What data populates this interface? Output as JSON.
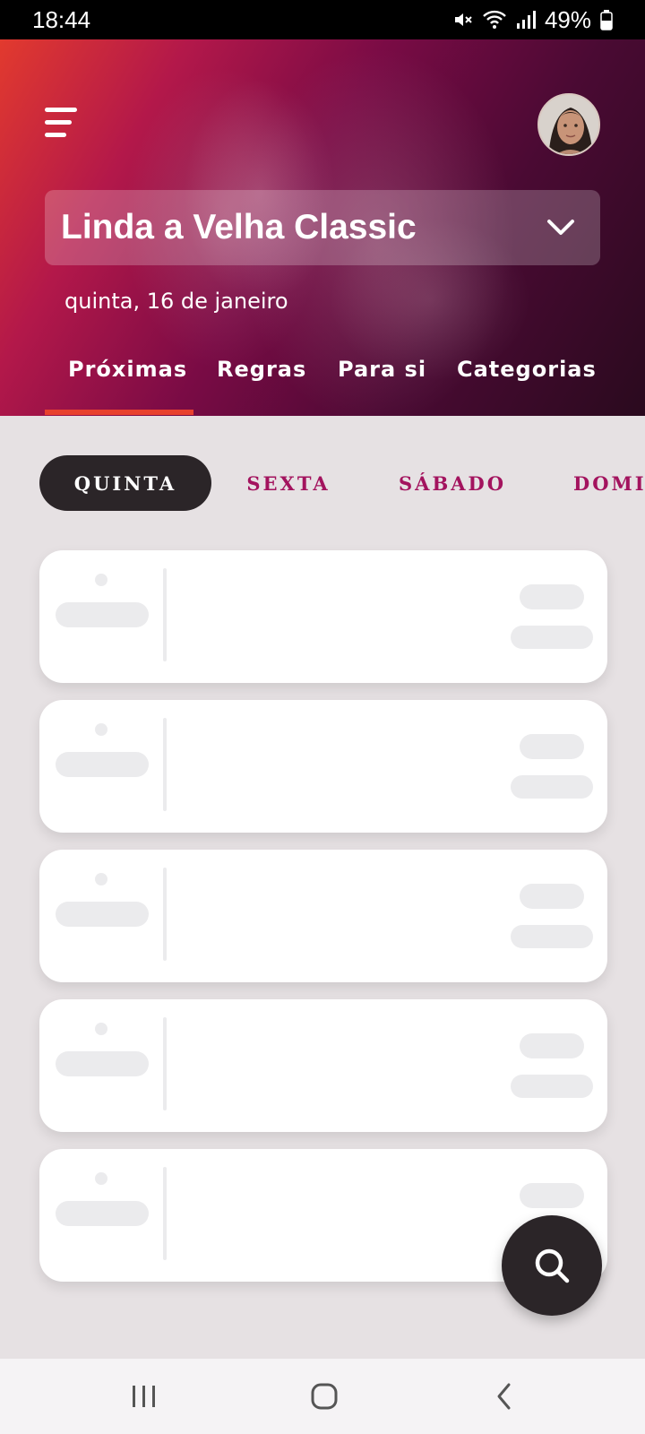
{
  "status_bar": {
    "time": "18:44",
    "battery": "49%",
    "icons": [
      "mute-icon",
      "wifi-icon",
      "signal-icon",
      "battery-icon"
    ]
  },
  "header": {
    "menu_icon": "hamburger-menu-icon",
    "venue": "Linda a Velha Classic",
    "date": "quinta, 16 de janeiro",
    "tabs": [
      {
        "label": "Próximas",
        "active": true
      },
      {
        "label": "Regras",
        "active": false
      },
      {
        "label": "Para si",
        "active": false
      },
      {
        "label": "Categorias",
        "active": false
      }
    ]
  },
  "days": [
    {
      "label": "QUINTA",
      "active": true
    },
    {
      "label": "SEXTA",
      "active": false
    },
    {
      "label": "SÁBADO",
      "active": false
    },
    {
      "label": "DOMI",
      "active": false
    }
  ],
  "colors": {
    "accent": "#a3135e",
    "tab_indicator": "#e8412e",
    "dark": "#2b2528"
  },
  "fab_icon": "search-icon",
  "nav": [
    "recent-apps-icon",
    "home-icon",
    "back-icon"
  ]
}
